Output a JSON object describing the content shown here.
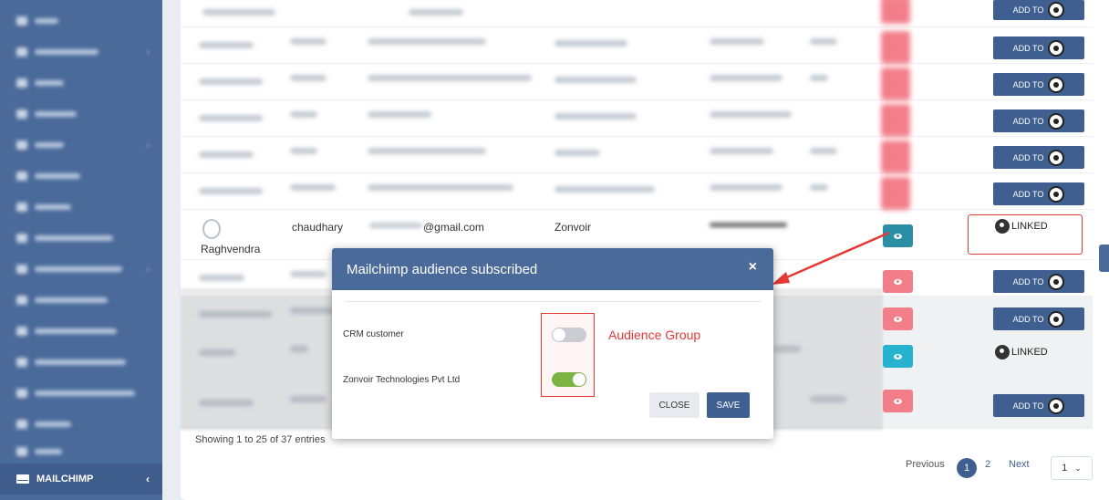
{
  "sidebar": {
    "active_label": "MAILCHIMP",
    "active_chevron": "‹"
  },
  "table": {
    "visible_row": {
      "name": "Raghvendra",
      "lastname": "chaudhary",
      "email": "@gmail.com",
      "company": "Zonvoir"
    },
    "linked_label": "LINKED",
    "addto_label": "ADD TO",
    "footer_info": "Showing 1 to 25 of 37 entries"
  },
  "modal": {
    "title": "Mailchimp audience subscribed",
    "close_x": "×",
    "items": [
      {
        "label": "CRM customer",
        "enabled": false
      },
      {
        "label": "Zonvoir Technologies Pvt Ltd",
        "enabled": true
      }
    ],
    "close_button": "CLOSE",
    "save_button": "SAVE"
  },
  "annotation": {
    "text": "Audience Group"
  },
  "pagination": {
    "previous": "Previous",
    "current": "1",
    "page2": "2",
    "next": "Next",
    "page_select": "1"
  },
  "colors": {
    "primary": "#3e5f8f",
    "sidebar": "#4a6a9a",
    "danger": "#f27e8a",
    "info": "#27b3cf",
    "teal": "#2a8fa5",
    "toggle_on": "#7cb342",
    "annotation": "#e53935"
  }
}
